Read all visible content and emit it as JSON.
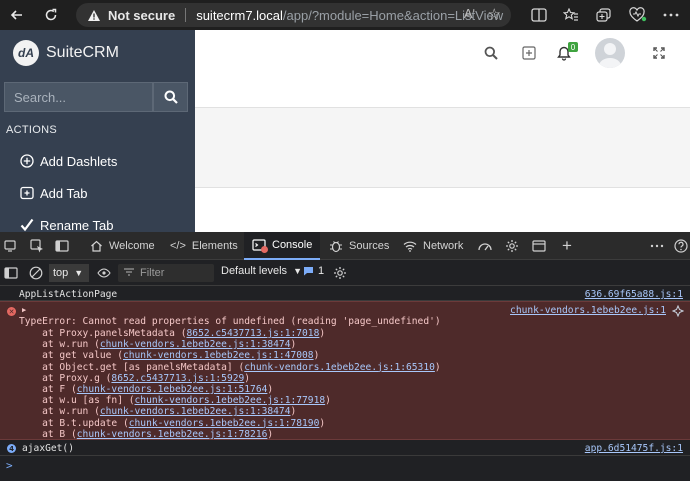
{
  "browser": {
    "not_secure": "Not secure",
    "url_host": "suitecrm7.local",
    "url_path": "/app/?module=Home&action=ListView",
    "read_aloud": "Aʹ"
  },
  "crm": {
    "logo_mark": "dA",
    "brand": "SuiteCRM",
    "search_placeholder": "Search...",
    "actions_header": "ACTIONS",
    "actions": [
      {
        "label": "Add Dashlets",
        "icon": "plus-circle-icon"
      },
      {
        "label": "Add Tab",
        "icon": "add-tab-icon"
      },
      {
        "label": "Rename Tab",
        "icon": "checkmark-icon"
      }
    ],
    "notification_count": "0"
  },
  "devtools": {
    "tabs": [
      {
        "label": "Welcome",
        "icon": "home-icon"
      },
      {
        "label": "Elements",
        "icon": "code-icon"
      },
      {
        "label": "Console",
        "icon": "console-icon",
        "active": true
      },
      {
        "label": "Sources",
        "icon": "bug-icon"
      },
      {
        "label": "Network",
        "icon": "wifi-icon"
      }
    ],
    "context": "top",
    "filter_placeholder": "Filter",
    "levels": "Default levels",
    "issues_count": "1",
    "logs": {
      "first_text": "AppListActionPage",
      "first_src": "636.69f65a88.js:1",
      "error_src": "chunk-vendors.1ebeb2ee.js:1",
      "error_message": "TypeError: Cannot read properties of undefined (reading 'page_undefined')",
      "stack": [
        {
          "pre": "    at Proxy.panelsMetadata (",
          "link": "8652.c5437713.js:1:7018",
          "post": ")"
        },
        {
          "pre": "    at w.run (",
          "link": "chunk-vendors.1ebeb2ee.js:1:38474",
          "post": ")"
        },
        {
          "pre": "    at get value (",
          "link": "chunk-vendors.1ebeb2ee.js:1:47008",
          "post": ")"
        },
        {
          "pre": "    at Object.get [as panelsMetadata] (",
          "link": "chunk-vendors.1ebeb2ee.js:1:65310",
          "post": ")"
        },
        {
          "pre": "    at Proxy.g (",
          "link": "8652.c5437713.js:1:5929",
          "post": ")"
        },
        {
          "pre": "    at F (",
          "link": "chunk-vendors.1ebeb2ee.js:1:51764",
          "post": ")"
        },
        {
          "pre": "    at w.u [as fn] (",
          "link": "chunk-vendors.1ebeb2ee.js:1:77918",
          "post": ")"
        },
        {
          "pre": "    at w.run (",
          "link": "chunk-vendors.1ebeb2ee.js:1:38474",
          "post": ")"
        },
        {
          "pre": "    at B.t.update (",
          "link": "chunk-vendors.1ebeb2ee.js:1:78190",
          "post": ")"
        },
        {
          "pre": "    at B (",
          "link": "chunk-vendors.1ebeb2ee.js:1:78216",
          "post": ")"
        }
      ],
      "ajax_count": "4",
      "ajax_text": "ajaxGet()",
      "ajax_src": "app.6d51475f.js:1",
      "prompt": ">"
    }
  }
}
